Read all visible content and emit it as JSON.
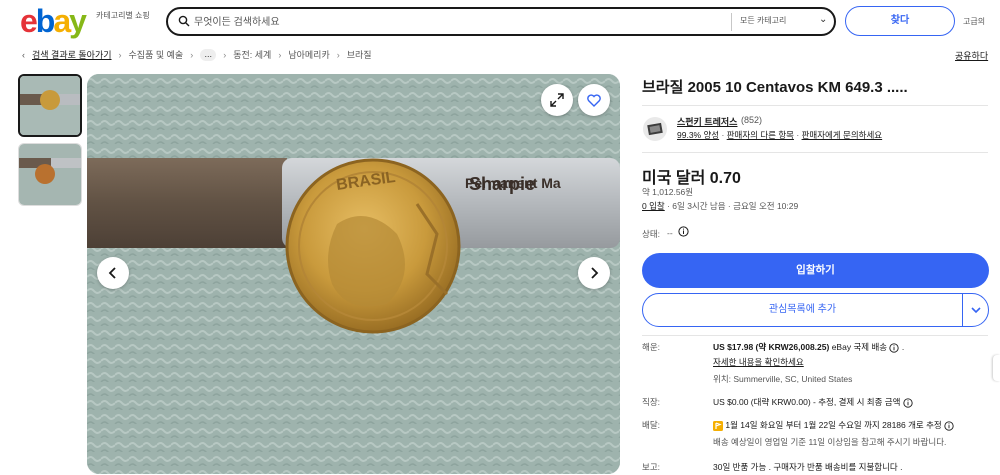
{
  "header": {
    "logo": "ebay",
    "category_shop": "카테고리별 쇼핑",
    "search_placeholder": "무엇이든 검색하세요",
    "category_select": "모든 카테고리",
    "search_button": "찾다",
    "advanced": "고급의"
  },
  "breadcrumb": {
    "back": "검색 결과로 돌아가기",
    "items": [
      "수집품 및 예술",
      "...",
      "동전: 세계",
      "남아메리카",
      "브라질"
    ],
    "share": "공유하다"
  },
  "item": {
    "title": "브라질 2005 10 Centavos KM 649.3 .....",
    "seller_name": "스펀키 트레저스",
    "seller_count": "(852)",
    "seller_positive": "99.3% 양성",
    "seller_other_items": "판매자의 다른 항목",
    "seller_contact": "판매자에게 문의하세요",
    "price": "미국 달러 0.70",
    "price_krw": "약 1,012.56원",
    "bids": "0 입찰",
    "time_left": " · 6일 3시간 남음 · 금요일 오전 10:29",
    "condition_label": "상태:",
    "condition_value": "--",
    "bid_button": "입찰하기",
    "watch_button": "관심목록에 추가"
  },
  "details": {
    "shipping_label": "해운:",
    "shipping_price": "US $17.98 (약 KRW26,008.25)",
    "shipping_method": " eBay 국제 배송",
    "shipping_link": "자세한 내용을 확인하세요",
    "location": "위치: Summerville, SC, United States",
    "import_label": "직장:",
    "import_value": "US $0.00 (대략 KRW0.00) - 추정, 결제 시 최종 금액",
    "delivery_label": "배달:",
    "delivery_value": "1월 14일 화요일 부터 1월 22일 수요일 까지 28186 개로 추정",
    "delivery_note": "배송 예상일이 영업일 기준 11일 이상임을 참고해 주시기 바랍니다.",
    "returns_label": "보고:",
    "returns_value": "30일 반품 가능 . 구매자가 반품 배송비를 지불합니다 ."
  },
  "colors": {
    "accent": "#3665f3",
    "logo_e": "#e53238",
    "logo_b": "#0064d2",
    "logo_a": "#f5af02",
    "logo_y": "#86b817"
  },
  "image": {
    "coin_text": "BRASIL",
    "marker_text": "Permanent Ma"
  }
}
